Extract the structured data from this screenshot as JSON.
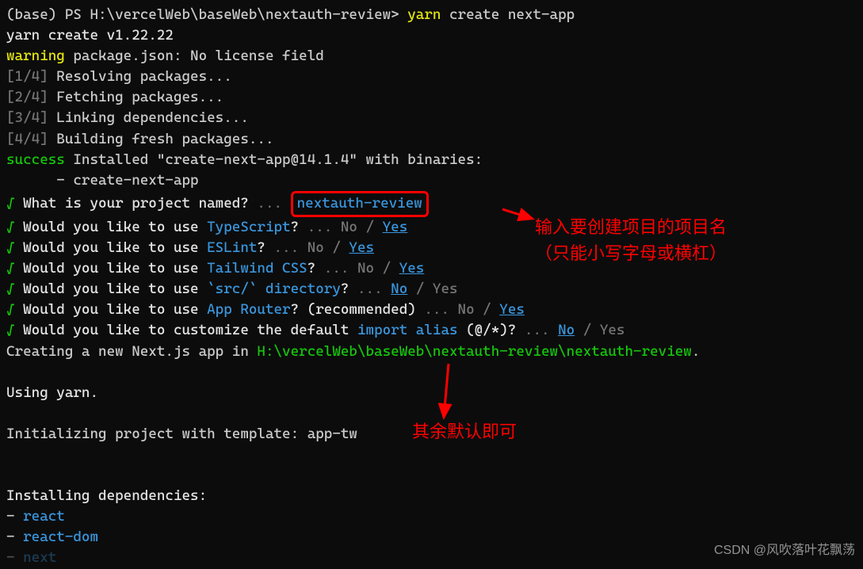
{
  "prompt": {
    "env": "(base) ",
    "ps": "PS ",
    "path": "H:\\vercelWeb\\baseWeb\\nextauth-review> ",
    "cmd1": "yarn",
    "cmd2": " create next-app"
  },
  "yarn_version": "yarn create v1.22.22",
  "warning": {
    "label": "warning",
    "text": " package.json: No license field"
  },
  "steps": [
    {
      "n": "[1/4]",
      "t": " Resolving packages..."
    },
    {
      "n": "[2/4]",
      "t": " Fetching packages..."
    },
    {
      "n": "[3/4]",
      "t": " Linking dependencies..."
    },
    {
      "n": "[4/4]",
      "t": " Building fresh packages..."
    }
  ],
  "success": {
    "label": "success",
    "text": " Installed \"create-next-app@14.1.4\" with binaries:"
  },
  "success_sub": "      - create-next-app",
  "q1": {
    "check": "√",
    "p": " What is your project named? ",
    "dots": "... ",
    "ans": "nextauth-review"
  },
  "qs": [
    {
      "check": "√",
      "p1": " Would you like to use ",
      "kw": "TypeScript",
      "p2": "?",
      "dots": " ... ",
      "no": "No",
      "sep": " / ",
      "yes": "Yes",
      "noSel": false
    },
    {
      "check": "√",
      "p1": " Would you like to use ",
      "kw": "ESLint",
      "p2": "?",
      "dots": " ... ",
      "no": "No",
      "sep": " / ",
      "yes": "Yes",
      "noSel": false
    },
    {
      "check": "√",
      "p1": " Would you like to use ",
      "kw": "Tailwind CSS",
      "p2": "?",
      "dots": " ... ",
      "no": "No",
      "sep": " / ",
      "yes": "Yes",
      "noSel": false
    },
    {
      "check": "√",
      "p1": " Would you like to use ",
      "kw": "`src/` directory",
      "p2": "?",
      "dots": " ... ",
      "no": "No",
      "sep": " / ",
      "yes": "Yes",
      "noSel": true
    },
    {
      "check": "√",
      "p1": " Would you like to use ",
      "kw": "App Router",
      "p2": "? (recommended)",
      "dots": " ... ",
      "no": "No",
      "sep": " / ",
      "yes": "Yes",
      "noSel": false
    }
  ],
  "q_alias": {
    "check": "√",
    "p1": " Would you like to customize the default ",
    "kw": "import alias",
    "p2": " (@/*)?",
    "dots": " ... ",
    "no": "No",
    "sep": " / ",
    "yes": "Yes"
  },
  "creating": {
    "pre": "Creating a new Next.js app in ",
    "path": "H:\\vercelWeb\\baseWeb\\nextauth-review\\nextauth-review",
    "dot": "."
  },
  "using_yarn": "Using yarn.",
  "init_template": "Initializing project with template: app-tw",
  "installing": "Installing dependencies:",
  "deps": [
    {
      "dash": "- ",
      "name": "react"
    },
    {
      "dash": "- ",
      "name": "react-dom"
    }
  ],
  "dep_cut": {
    "dash": "- ",
    "name": "next"
  },
  "annotations": {
    "a1_l1": "输入要创建项目的项目名",
    "a1_l2": "（只能小写字母或横杠）",
    "a2": "其余默认即可"
  },
  "watermark": "CSDN @风吹落叶花飘荡"
}
